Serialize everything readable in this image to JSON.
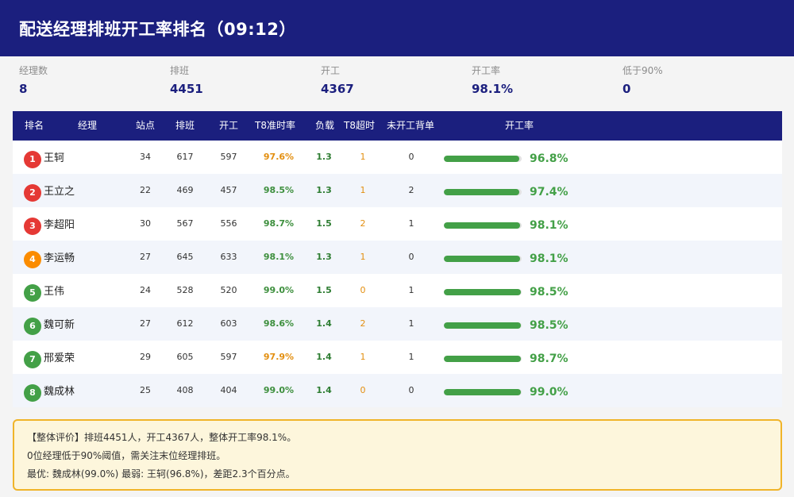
{
  "header": {
    "title": "配送经理排班开工率排名（09:12）"
  },
  "stats": [
    {
      "label": "经理数",
      "value": "8"
    },
    {
      "label": "排班",
      "value": "4451"
    },
    {
      "label": "开工",
      "value": "4367"
    },
    {
      "label": "开工率",
      "value": "98.1%"
    },
    {
      "label": "低于90%",
      "value": "0"
    }
  ],
  "table": {
    "columns": [
      "排名",
      "经理",
      "站点",
      "排班",
      "开工",
      "T8准时率",
      "负载",
      "T8超时",
      "未开工背单",
      "开工率"
    ],
    "rows": [
      {
        "rank": "1",
        "name": "王轲",
        "sites": "34",
        "scheduled": "617",
        "started": "597",
        "t8_rate": "97.6%",
        "load": "1.3",
        "t8_over": "1",
        "not_started": "0",
        "rate": "96.8%",
        "rate_value": 96.8,
        "badge_color": "#e53935",
        "t8_level": "warn"
      },
      {
        "rank": "2",
        "name": "王立之",
        "sites": "22",
        "scheduled": "469",
        "started": "457",
        "t8_rate": "98.5%",
        "load": "1.3",
        "t8_over": "1",
        "not_started": "2",
        "rate": "97.4%",
        "rate_value": 97.4,
        "badge_color": "#e53935",
        "t8_level": "good"
      },
      {
        "rank": "3",
        "name": "李超阳",
        "sites": "30",
        "scheduled": "567",
        "started": "556",
        "t8_rate": "98.7%",
        "load": "1.5",
        "t8_over": "2",
        "not_started": "1",
        "rate": "98.1%",
        "rate_value": 98.1,
        "badge_color": "#e53935",
        "t8_level": "good"
      },
      {
        "rank": "4",
        "name": "李运畅",
        "sites": "27",
        "scheduled": "645",
        "started": "633",
        "t8_rate": "98.1%",
        "load": "1.3",
        "t8_over": "1",
        "not_started": "0",
        "rate": "98.1%",
        "rate_value": 98.1,
        "badge_color": "#fb8c00",
        "t8_level": "good"
      },
      {
        "rank": "5",
        "name": "王伟",
        "sites": "24",
        "scheduled": "528",
        "started": "520",
        "t8_rate": "99.0%",
        "load": "1.5",
        "t8_over": "0",
        "not_started": "1",
        "rate": "98.5%",
        "rate_value": 98.5,
        "badge_color": "#43a047",
        "t8_level": "good"
      },
      {
        "rank": "6",
        "name": "魏可新",
        "sites": "27",
        "scheduled": "612",
        "started": "603",
        "t8_rate": "98.6%",
        "load": "1.4",
        "t8_over": "2",
        "not_started": "1",
        "rate": "98.5%",
        "rate_value": 98.5,
        "badge_color": "#43a047",
        "t8_level": "good"
      },
      {
        "rank": "7",
        "name": "邢爱荣",
        "sites": "29",
        "scheduled": "605",
        "started": "597",
        "t8_rate": "97.9%",
        "load": "1.4",
        "t8_over": "1",
        "not_started": "1",
        "rate": "98.7%",
        "rate_value": 98.7,
        "badge_color": "#43a047",
        "t8_level": "warn"
      },
      {
        "rank": "8",
        "name": "魏成林",
        "sites": "25",
        "scheduled": "408",
        "started": "404",
        "t8_rate": "99.0%",
        "load": "1.4",
        "t8_over": "0",
        "not_started": "0",
        "rate": "99.0%",
        "rate_value": 99.0,
        "badge_color": "#43a047",
        "t8_level": "good"
      }
    ]
  },
  "summary": {
    "lines": [
      "【整体评价】排班4451人，开工4367人，整体开工率98.1%。",
      "0位经理低于90%阈值，需关注末位经理排班。",
      "最优: 魏成林(99.0%)  最弱: 王轲(96.8%)，差距2.3个百分点。"
    ]
  },
  "colors": {
    "header_bg": "#1b1f7e",
    "good": "#43a047",
    "warn": "#e38f10",
    "summary_border": "#f0b429"
  }
}
